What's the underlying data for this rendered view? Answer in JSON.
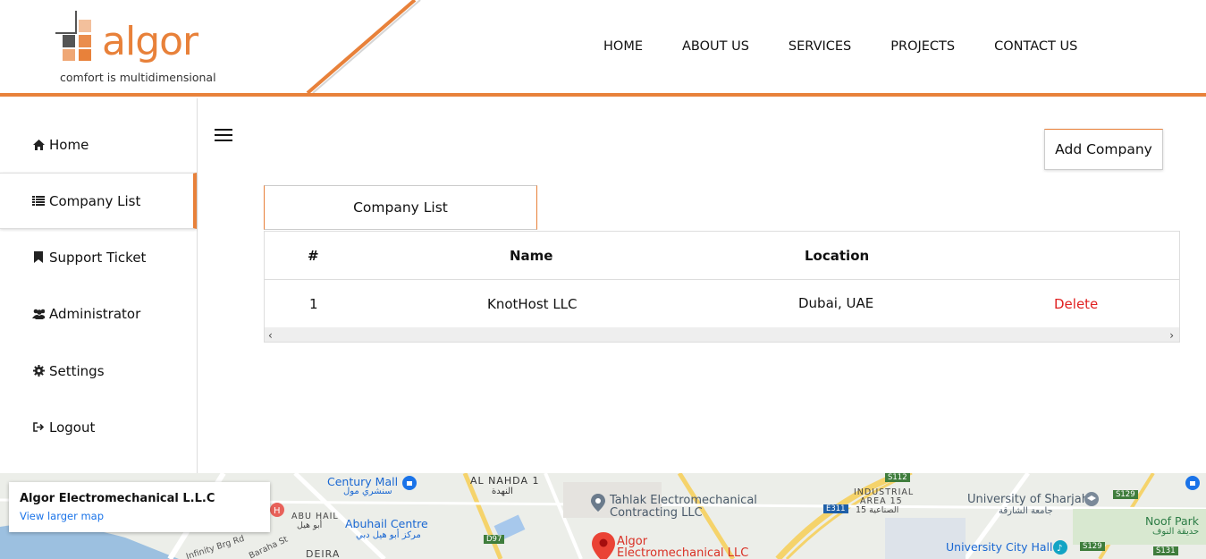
{
  "brand": {
    "name": "algor",
    "tagline": "comfort is multidimensional",
    "accent": "#e8813a"
  },
  "nav": [
    "HOME",
    "ABOUT US",
    "SERVICES",
    "PROJECTS",
    "CONTACT US"
  ],
  "sidebar": {
    "items": [
      {
        "label": "Home",
        "icon": "home-icon"
      },
      {
        "label": "Company List",
        "icon": "list-icon"
      },
      {
        "label": "Support Ticket",
        "icon": "bookmark-icon"
      },
      {
        "label": "Administrator",
        "icon": "users-icon"
      },
      {
        "label": "Settings",
        "icon": "gear-icon"
      },
      {
        "label": "Logout",
        "icon": "logout-icon"
      }
    ],
    "active": "Company List"
  },
  "toolbar": {
    "add_label": "Add Company"
  },
  "tab": {
    "label": "Company List"
  },
  "table": {
    "headers": [
      "#",
      "Name",
      "Location"
    ],
    "rows": [
      {
        "num": "1",
        "name": "KnotHost LLC",
        "location": "Dubai, UAE",
        "action": "Delete"
      }
    ]
  },
  "map": {
    "card_title": "Algor Electromechanical L.L.C",
    "card_link": "View larger map",
    "labels": {
      "century_mall": "Century Mall",
      "century_mall_ar": "سنشري مول",
      "al_nahda": "AL NAHDA 1",
      "al_nahda_ar": "النهدة",
      "tahlak1": "Tahlak Electromechanical",
      "tahlak2": "Contracting LLC",
      "industrial1": "INDUSTRIAL",
      "industrial2": "AREA 15",
      "industrial_ar": "الصناعية 15",
      "uni_sharjah": "University of Sharjah",
      "uni_sharjah_ar": "جامعة الشارقة",
      "noof_park": "Noof Park",
      "noof_park_ar": "حديقة النوف",
      "abu_hail": "ABU HAIL",
      "abu_hail_ar": "أبو هيل",
      "abuhail_centre": "Abuhail Centre",
      "abuhail_centre_ar": "مركز أبو هيل دبي",
      "algor1": "Algor",
      "algor2": "Electromechanical LLC",
      "uni_city_hall": "University City Hall",
      "deira": "DEIRA",
      "infinity": "Infinity Brg Rd",
      "baraha": "Baraha St",
      "d97": "D97",
      "e311": "E311",
      "s112": "S112",
      "s129": "S129",
      "s131": "S131"
    }
  }
}
